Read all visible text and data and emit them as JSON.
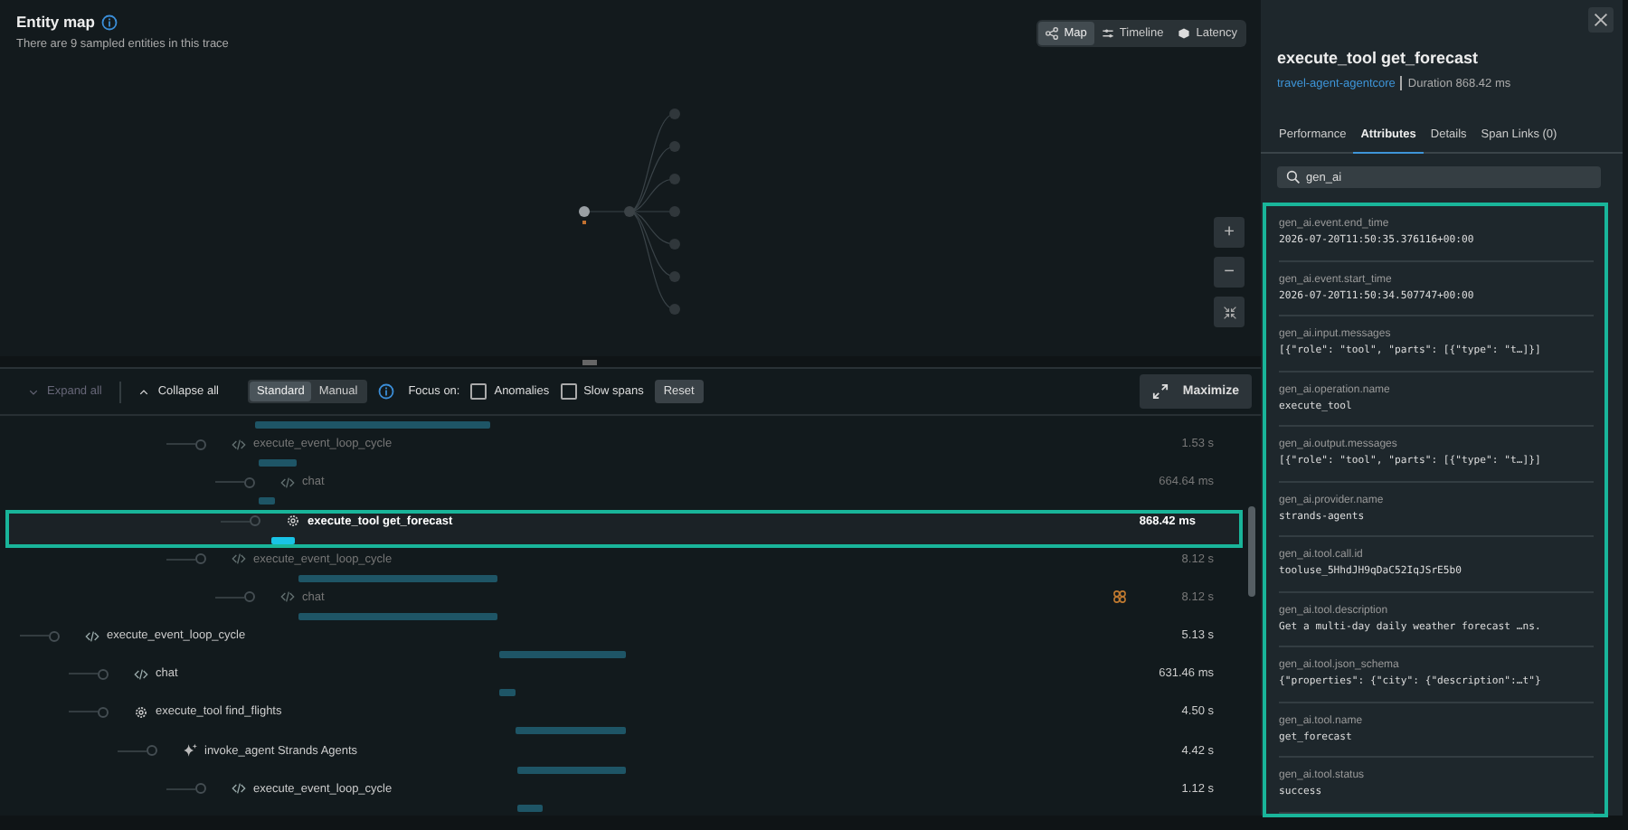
{
  "entity_map": {
    "title": "Entity map",
    "subtitle": "There are 9 sampled entities in this trace",
    "views": [
      {
        "label": "Map",
        "selected": true
      },
      {
        "label": "Timeline",
        "selected": false
      },
      {
        "label": "Latency",
        "selected": false
      }
    ],
    "zoom_controls": [
      "+",
      "−"
    ]
  },
  "toolbar": {
    "expand_all": {
      "label": "Expand all",
      "disabled": true
    },
    "collapse_all": {
      "label": "Collapse all",
      "disabled": false
    },
    "modes": [
      {
        "label": "Standard",
        "selected": true
      },
      {
        "label": "Manual",
        "selected": false
      }
    ],
    "focus_label": "Focus on:",
    "filters": [
      {
        "label": "Anomalies",
        "checked": false
      },
      {
        "label": "Slow spans",
        "checked": false
      }
    ],
    "reset": "Reset",
    "maximize": "Maximize"
  },
  "spans": [
    {
      "children": [
        {
          "children": [
            {
              "children": [
                {
                  "name": "execute_event_loop_cycle",
                  "duration": "1.53 s",
                  "kind": "code",
                  "dimmed": true,
                  "selected": false,
                  "children": [
                    {
                      "name": "chat",
                      "duration": "664.64 ms",
                      "kind": "code",
                      "dimmed": true,
                      "selected": false
                    },
                    {
                      "name": "execute_tool get_forecast",
                      "duration": "868.42 ms",
                      "kind": "tool",
                      "dimmed": false,
                      "selected": true
                    }
                  ]
                },
                {
                  "name": "execute_event_loop_cycle",
                  "duration": "8.12 s",
                  "kind": "code",
                  "dimmed": true,
                  "selected": false,
                  "children": [
                    {
                      "name": "chat",
                      "duration": "8.12 s",
                      "kind": "code",
                      "dimmed": true,
                      "selected": false,
                      "flagged": true
                    }
                  ]
                }
              ]
            }
          ]
        }
      ]
    },
    {
      "name": "execute_event_loop_cycle",
      "duration": "5.13 s",
      "kind": "code",
      "dimmed": false,
      "selected": false,
      "children": [
        {
          "name": "chat",
          "duration": "631.46 ms",
          "kind": "code",
          "dimmed": false,
          "selected": false
        },
        {
          "name": "execute_tool find_flights",
          "duration": "4.50 s",
          "kind": "tool",
          "dimmed": false,
          "selected": false,
          "children": [
            {
              "name": "invoke_agent Strands Agents",
              "duration": "4.42 s",
              "kind": "agent",
              "dimmed": false,
              "selected": false,
              "children": [
                {
                  "name": "execute_event_loop_cycle",
                  "duration": "1.12 s",
                  "kind": "code",
                  "dimmed": false,
                  "selected": false
                }
              ]
            }
          ]
        }
      ]
    }
  ],
  "details": {
    "title": "execute_tool get_forecast",
    "service": "travel-agent-agentcore",
    "duration": "Duration 868.42 ms",
    "tabs": [
      {
        "label": "Performance",
        "selected": false
      },
      {
        "label": "Attributes",
        "selected": true
      },
      {
        "label": "Details",
        "selected": false
      },
      {
        "label": "Span Links (0)",
        "selected": false
      }
    ],
    "search": {
      "value": "gen_ai"
    },
    "attributes": [
      {
        "key": "gen_ai.event.end_time",
        "value": "2026-07-20T11:50:35.376116+00:00"
      },
      {
        "key": "gen_ai.event.start_time",
        "value": "2026-07-20T11:50:34.507747+00:00"
      },
      {
        "key": "gen_ai.input.messages",
        "value": "[{\"role\": \"tool\", \"parts\": [{\"type\": \"t…]}]"
      },
      {
        "key": "gen_ai.operation.name",
        "value": "execute_tool"
      },
      {
        "key": "gen_ai.output.messages",
        "value": "[{\"role\": \"tool\", \"parts\": [{\"type\": \"t…]}]"
      },
      {
        "key": "gen_ai.provider.name",
        "value": "strands-agents"
      },
      {
        "key": "gen_ai.tool.call.id",
        "value": "tooluse_5HhdJH9qDaC52IqJSrE5b0"
      },
      {
        "key": "gen_ai.tool.description",
        "value": "Get a multi-day daily weather forecast …ns."
      },
      {
        "key": "gen_ai.tool.json_schema",
        "value": "{\"properties\": {\"city\": {\"description\":…t\"}"
      },
      {
        "key": "gen_ai.tool.name",
        "value": "get_forecast"
      },
      {
        "key": "gen_ai.tool.status",
        "value": "success"
      }
    ]
  }
}
